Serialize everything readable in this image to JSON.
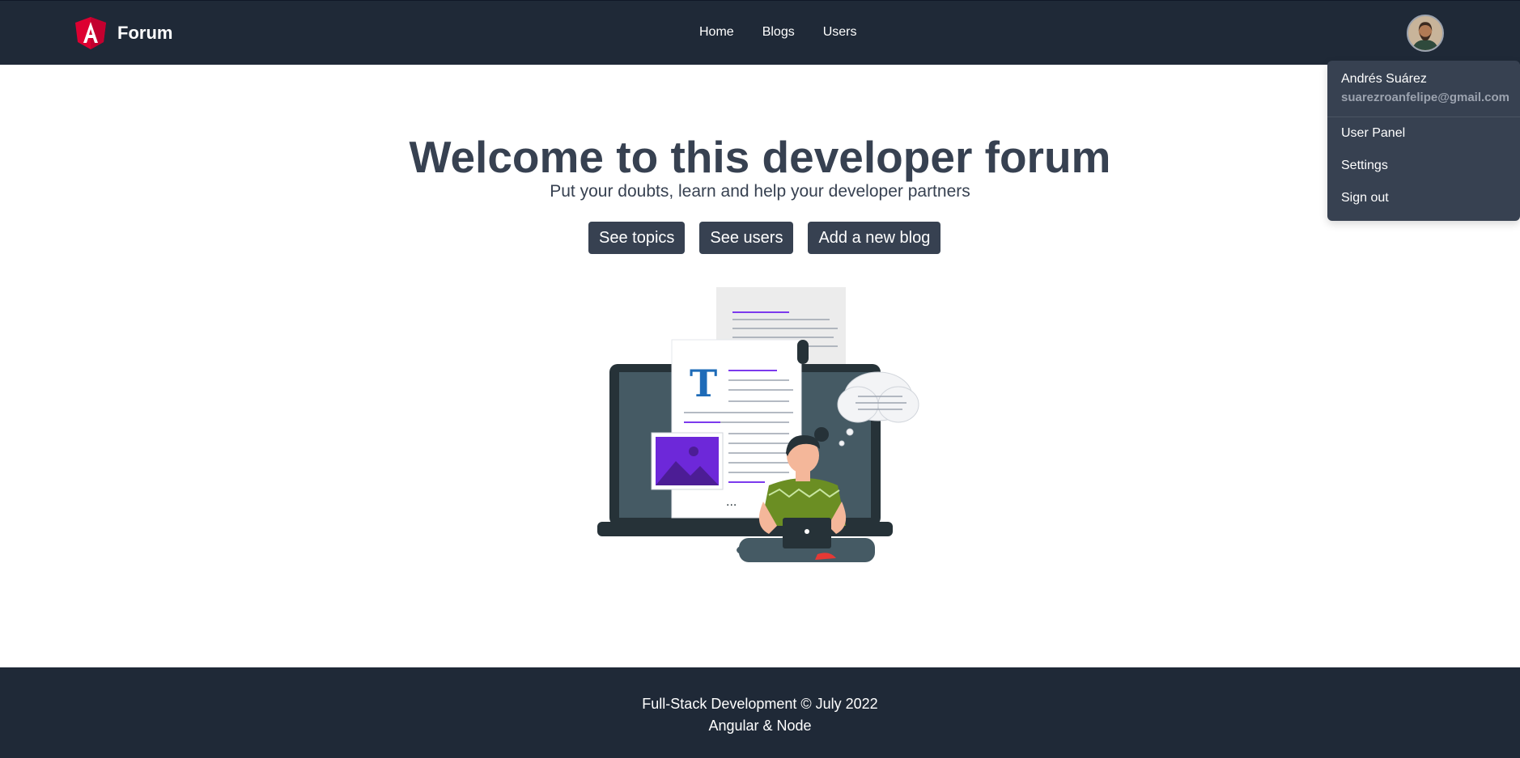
{
  "brand": {
    "name": "Forum",
    "logo_icon": "angular-logo-icon"
  },
  "nav": {
    "links": [
      {
        "label": "Home"
      },
      {
        "label": "Blogs"
      },
      {
        "label": "Users"
      }
    ]
  },
  "user_menu": {
    "name": "Andrés Suárez",
    "email": "suarezroanfelipe@gmail.com",
    "items": [
      {
        "label": "User Panel"
      },
      {
        "label": "Settings"
      },
      {
        "label": "Sign out"
      }
    ]
  },
  "hero": {
    "title": "Welcome to this developer forum",
    "subtitle": "Put your doubts, learn and help your developer partners",
    "buttons": [
      {
        "label": "See topics"
      },
      {
        "label": "See users"
      },
      {
        "label": "Add a new blog"
      }
    ],
    "illustration_letter": "T",
    "illustration_ellipsis": "..."
  },
  "footer": {
    "line1": "Full-Stack Development © July 2022",
    "line2": "Angular & Node"
  },
  "colors": {
    "navbar": "#1f2937",
    "dropdown": "#374151",
    "button": "#374151",
    "accent_logo": "#dd0031",
    "illustration_purple": "#7c3aed"
  }
}
